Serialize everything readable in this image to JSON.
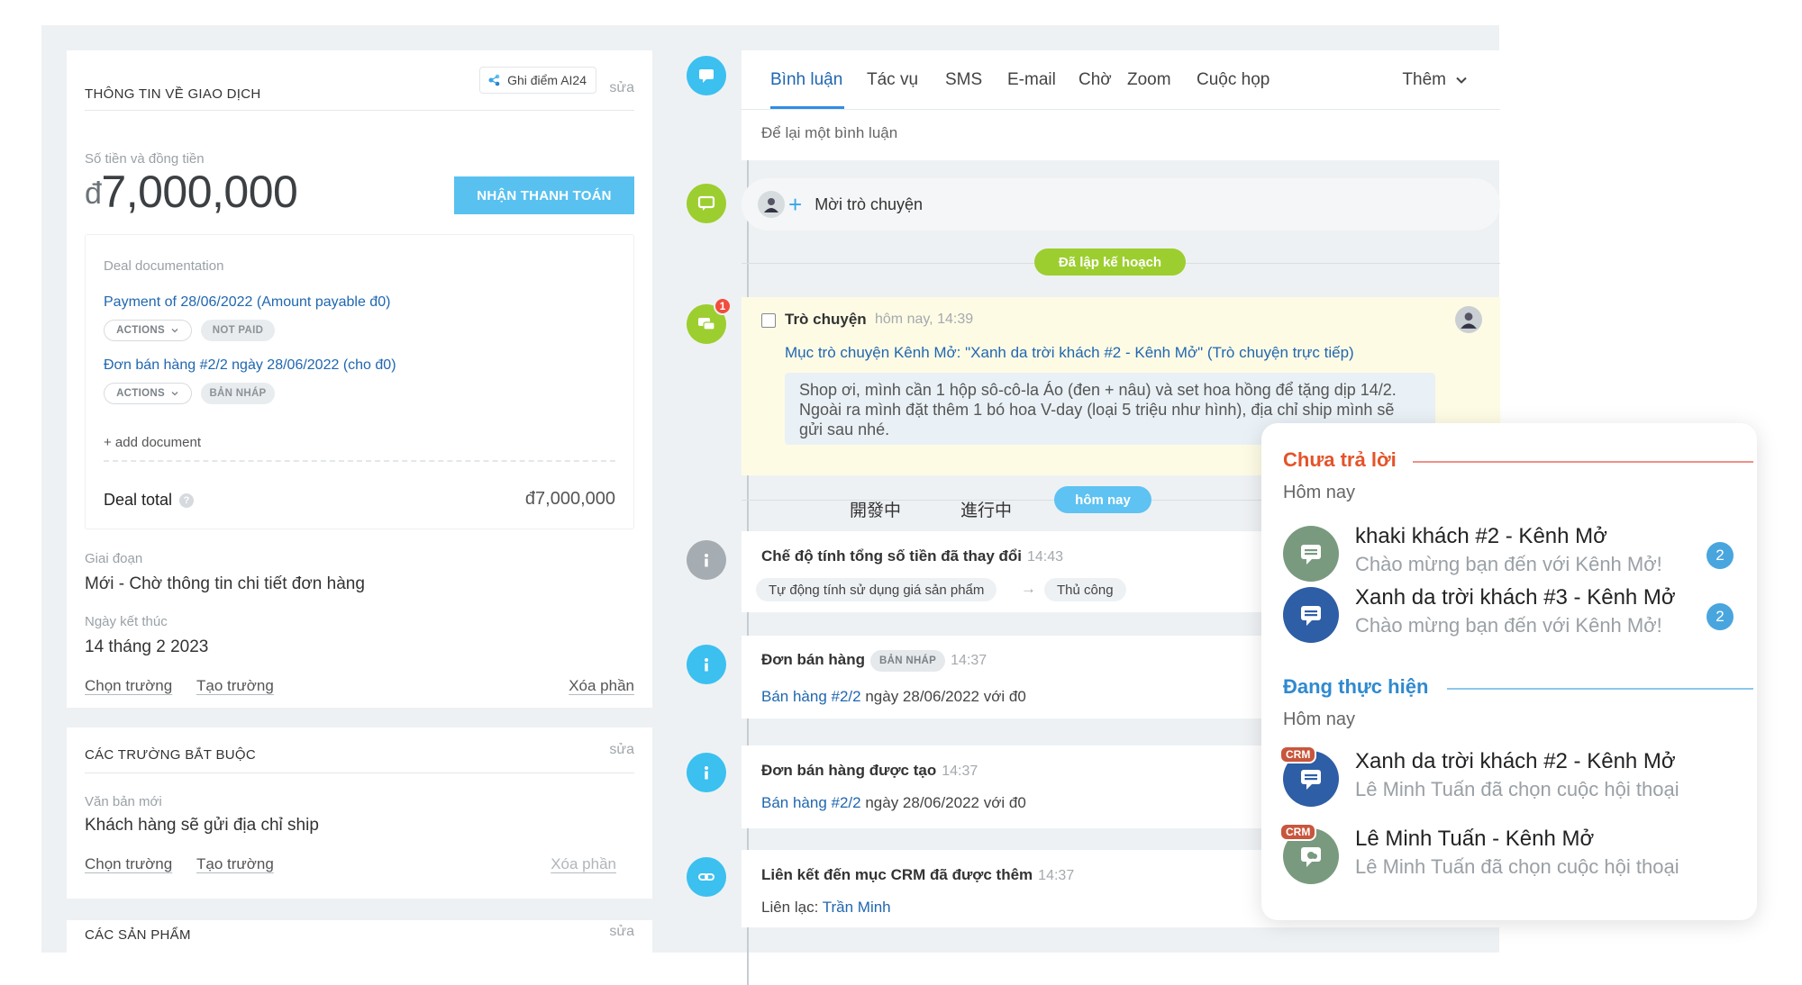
{
  "deal_info": {
    "title": "THÔNG TIN VỀ GIAO DỊCH",
    "ai_badge": "Ghi điểm AI24",
    "edit": "sửa",
    "amount_label": "Số tiền và đồng tiền",
    "currency_symbol": "đ",
    "amount": "7,000,000",
    "pay_button": "NHẬN THANH TOÁN",
    "documentation": {
      "label": "Deal documentation",
      "items": [
        {
          "link": "Payment of 28/06/2022 (Amount payable đ0)",
          "actions": "ACTIONS",
          "status": "NOT PAID"
        },
        {
          "link": "Đơn bán hàng #2/2 ngày 28/06/2022 (cho đ0)",
          "actions": "ACTIONS",
          "status": "BẢN NHÁP"
        }
      ],
      "add_document": "+ add document",
      "total_label": "Deal total",
      "total_value": "đ7,000,000"
    },
    "stage_label": "Giai đoạn",
    "stage_value": "Mới - Chờ thông tin chi tiết đơn hàng",
    "end_date_label": "Ngày kết thúc",
    "end_date_value": "14 tháng 2 2023",
    "select_field": "Chọn trường",
    "create_field": "Tạo trường",
    "delete_section": "Xóa phần"
  },
  "required_fields": {
    "title": "CÁC TRƯỜNG BẮT BUỘC",
    "edit": "sửa",
    "label": "Văn bản mới",
    "value": "Khách hàng sẽ gửi địa chỉ ship",
    "select_field": "Chọn trường",
    "create_field": "Tạo trường",
    "delete_section": "Xóa phần"
  },
  "products": {
    "title": "CÁC SẢN PHẨM",
    "edit": "sửa"
  },
  "composer": {
    "tabs": [
      "Bình luận",
      "Tác vụ",
      "SMS",
      "E-mail",
      "Chờ",
      "Zoom",
      "Cuộc họp"
    ],
    "more": "Thêm",
    "placeholder": "Để lại một bình luận"
  },
  "invite": {
    "text": "Mời trò chuyện"
  },
  "planned_chip": "Đã lập kế hoạch",
  "chat": {
    "badge": "1",
    "title": "Trò chuyện",
    "time": "hôm nay, 14:39",
    "subtitle": "Mục trò chuyện Kênh Mở: \"Xanh da trời khách #2 - Kênh Mở\" (Trò chuyện trực tiếp)",
    "message": "Shop ơi, mình cần 1 hộp sô-cô-la Áo (đen + nâu) và set hoa hồng để tặng dịp 14/2. Ngoài ra mình đặt thêm 1 bó hoa V-day (loại 5 triệu như hình), địa chỉ ship mình sẽ gửi sau nhé."
  },
  "cjk_labels": [
    "開發中",
    "進行中"
  ],
  "today_chip": "hôm nay",
  "events": [
    {
      "title": "Chế độ tính tổng số tiền đã thay đổi",
      "time": "14:43",
      "from": "Tự động tính sử dụng giá sản phẩm",
      "to": "Thủ công"
    },
    {
      "title": "Đơn bán hàng",
      "status": "BẢN NHÁP",
      "time": "14:37",
      "link": "Bán hàng #2/2",
      "rest": " ngày 28/06/2022 với đ0"
    },
    {
      "title": "Đơn bán hàng được tạo",
      "time": "14:37",
      "link": "Bán hàng #2/2",
      "rest": " ngày 28/06/2022 với đ0"
    },
    {
      "title": "Liên kết đến mục CRM đã được thêm",
      "time": "14:37",
      "contact_label": "Liên lạc: ",
      "contact": "Trần Minh"
    }
  ],
  "popup": {
    "unanswered": "Chưa trả lời",
    "in_progress": "Đang thực hiện",
    "today": "Hôm nay",
    "unanswered_items": [
      {
        "name": "khaki khách #2 - Kênh Mở",
        "message": "Chào mừng bạn đến với Kênh Mở!",
        "count": "2"
      },
      {
        "name": "Xanh da trời khách #3 - Kênh Mở",
        "message": "Chào mừng bạn đến với Kênh Mở!",
        "count": "2"
      }
    ],
    "progress_items": [
      {
        "tag": "CRM",
        "name": "Xanh da trời khách #2 - Kênh Mở",
        "message": "Lê Minh Tuấn đã chọn cuộc hội thoại"
      },
      {
        "tag": "CRM",
        "name": "Lê Minh Tuấn - Kênh Mở",
        "message": "Lê Minh Tuấn đã chọn cuộc hội thoại"
      }
    ]
  },
  "colors": {
    "accent_blue": "#2067b0",
    "button_blue": "#58c1f0",
    "timeline_green": "#9cce2f",
    "badge_red": "#f14c3d",
    "popup_red": "#e4532a"
  }
}
